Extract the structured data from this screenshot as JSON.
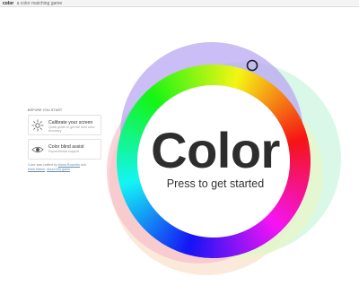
{
  "header": {
    "brand": "color",
    "tagline": "a color matching game"
  },
  "sidebar": {
    "heading": "Before you start",
    "cards": [
      {
        "title": "Calibrate your screen",
        "subtitle": "Quick guide to get the best color accuracy",
        "icon": "sun-icon"
      },
      {
        "title": "Color blind assist",
        "subtitle": "Experimental support",
        "icon": "eye-icon"
      }
    ],
    "credits_prefix": "Color was crafted by",
    "credit_name_1": "Maria Rossetto",
    "credits_and": "and",
    "credit_name_2": "Mark Weber",
    "about_link": "About this game"
  },
  "main": {
    "title": "Color",
    "subtitle": "Press to get started"
  },
  "colors": {
    "blob_violet": "#b9a7f3",
    "blob_mint": "#c9f5dd",
    "blob_pink": "#f6b8c4",
    "blob_peach": "#f8d9bd",
    "blob_lime": "#e9f7c8"
  }
}
